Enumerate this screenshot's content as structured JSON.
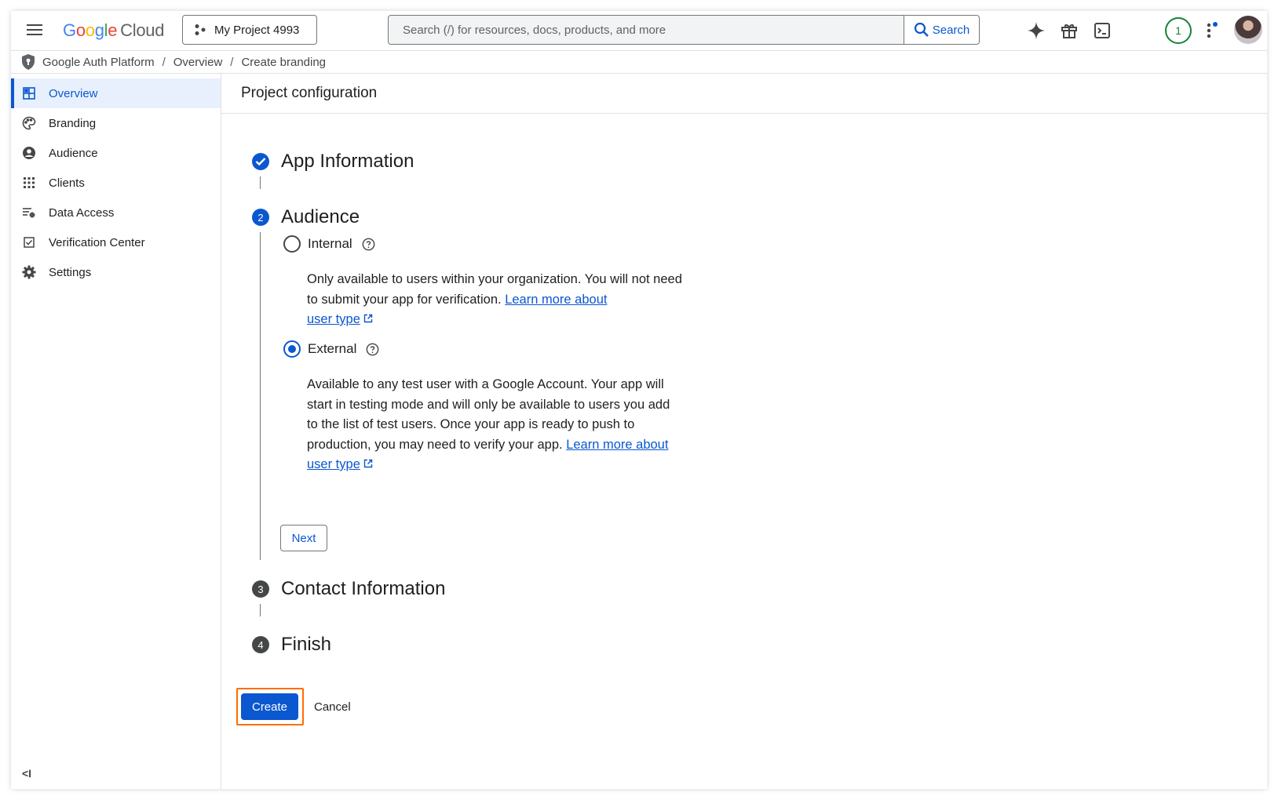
{
  "topbar": {
    "logo_parts": [
      "G",
      "o",
      "o",
      "g",
      "l",
      "e"
    ],
    "logo_cloud": "Cloud",
    "project_name": "My Project 4993",
    "search_placeholder": "Search (/) for resources, docs, products, and more",
    "search_button": "Search",
    "notification_count": "1",
    "icons": [
      "gemini-spark-icon",
      "gift-icon",
      "terminal-icon",
      "more-vert-icon"
    ]
  },
  "breadcrumb": {
    "items": [
      "Google Auth Platform",
      "Overview",
      "Create branding"
    ],
    "separator": "/"
  },
  "sidebar": {
    "items": [
      {
        "label": "Overview",
        "icon": "dashboard-icon",
        "active": true
      },
      {
        "label": "Branding",
        "icon": "palette-icon"
      },
      {
        "label": "Audience",
        "icon": "account-circle-icon"
      },
      {
        "label": "Clients",
        "icon": "apps-grid-icon"
      },
      {
        "label": "Data Access",
        "icon": "data-settings-icon"
      },
      {
        "label": "Verification Center",
        "icon": "checkbox-icon"
      },
      {
        "label": "Settings",
        "icon": "gear-icon"
      }
    ],
    "collapse_label": "<I"
  },
  "main": {
    "title": "Project configuration",
    "steps": [
      {
        "number": "",
        "title": "App Information",
        "state": "done"
      },
      {
        "number": "2",
        "title": "Audience",
        "state": "active"
      },
      {
        "number": "3",
        "title": "Contact Information",
        "state": "pending"
      },
      {
        "number": "4",
        "title": "Finish",
        "state": "pending"
      }
    ],
    "audience": {
      "internal": {
        "label": "Internal",
        "checked": false,
        "desc": "Only available to users within your organization. You will not need to submit your app for verification. ",
        "link1": "Learn more about",
        "link2": "user type"
      },
      "external": {
        "label": "External",
        "checked": true,
        "desc": "Available to any test user with a Google Account. Your app will start in testing mode and will only be available to users you add to the list of test users. Once your app is ready to push to production, you may need to verify your app. ",
        "link1": "Learn more about",
        "link2": "user type"
      },
      "next_button": "Next"
    },
    "create_button": "Create",
    "cancel_button": "Cancel"
  },
  "colors": {
    "primary": "#0b57d0",
    "highlight": "#ff6d00",
    "success": "#188038",
    "pending_step": "#444746"
  }
}
